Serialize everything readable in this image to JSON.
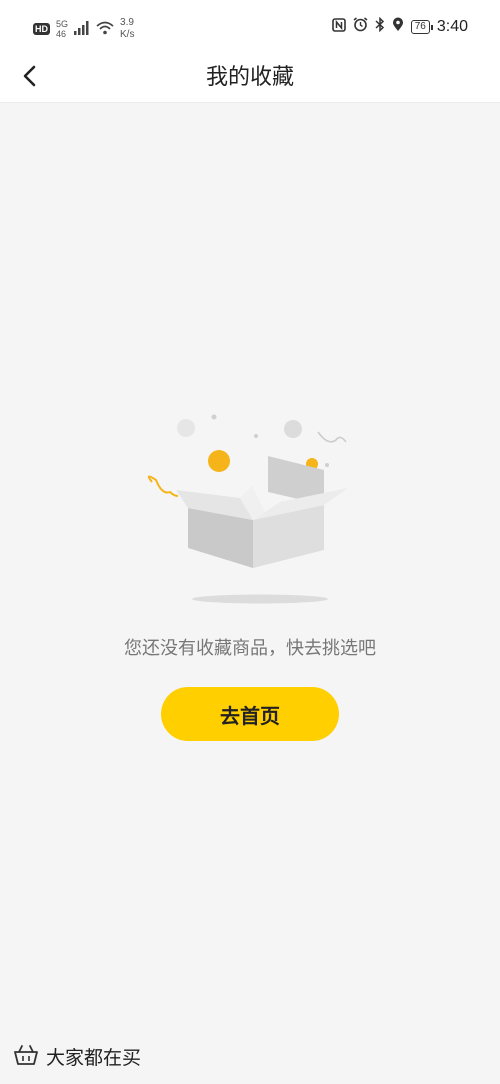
{
  "status_bar": {
    "hd": "HD",
    "network": "5G",
    "network_sub": "46",
    "speed_value": "3.9",
    "speed_unit": "K/s",
    "battery": "76",
    "time": "3:40"
  },
  "header": {
    "title": "我的收藏",
    "back_icon": "chevron-left-icon"
  },
  "empty_state": {
    "message": "您还没有收藏商品，快去挑选吧",
    "illustration": "empty-box-illustration"
  },
  "actions": {
    "go_home_label": "去首页"
  },
  "footer": {
    "label": "大家都在买",
    "icon": "basket-icon"
  },
  "colors": {
    "accent": "#ffcf00",
    "background": "#f5f5f5",
    "text_secondary": "#777777"
  }
}
